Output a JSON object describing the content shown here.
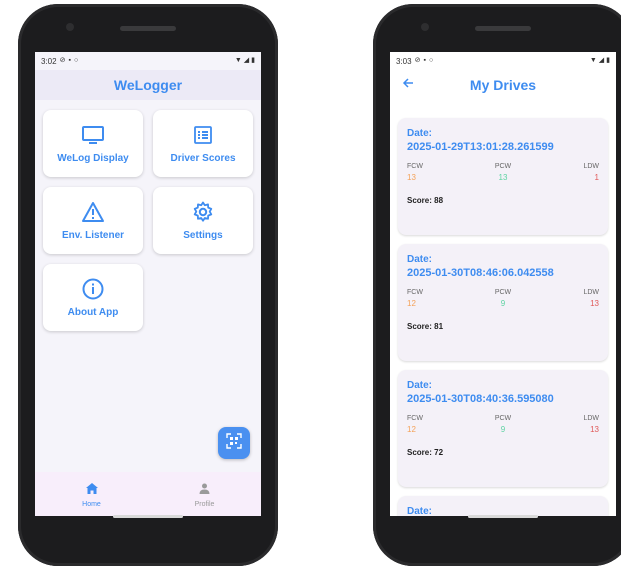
{
  "left_screen": {
    "status": {
      "time": "3:02"
    },
    "app_title": "WeLogger",
    "tiles": [
      {
        "label": "WeLog Display",
        "icon": "monitor-icon"
      },
      {
        "label": "Driver Scores",
        "icon": "list-icon"
      },
      {
        "label": "Env. Listener",
        "icon": "warning-icon"
      },
      {
        "label": "Settings",
        "icon": "gear-icon"
      },
      {
        "label": "About App",
        "icon": "info-icon"
      }
    ],
    "fab_icon": "qr-scan-icon",
    "nav": [
      {
        "label": "Home",
        "icon": "home-icon",
        "active": true
      },
      {
        "label": "Profile",
        "icon": "person-icon",
        "active": false
      }
    ]
  },
  "right_screen": {
    "status": {
      "time": "3:03"
    },
    "title": "My Drives",
    "date_label": "Date:",
    "metric_names": {
      "fcw": "FCW",
      "pcw": "PCW",
      "ldw": "LDW"
    },
    "drives": [
      {
        "date": "2025-01-29T13:01:28.261599",
        "fcw": "13",
        "pcw": "13",
        "ldw": "1",
        "score": "Score: 88"
      },
      {
        "date": "2025-01-30T08:46:06.042558",
        "fcw": "12",
        "pcw": "9",
        "ldw": "13",
        "score": "Score: 81"
      },
      {
        "date": "2025-01-30T08:40:36.595080",
        "fcw": "12",
        "pcw": "9",
        "ldw": "13",
        "score": "Score: 72"
      }
    ]
  },
  "colors": {
    "accent": "#3e8cf0",
    "fcw": "#f4a259",
    "pcw": "#5fd3a3",
    "ldw": "#e05a5a",
    "tile_background": "#ffffff",
    "card_background": "#f4f1f8",
    "nav_background": "#f8eefb"
  }
}
